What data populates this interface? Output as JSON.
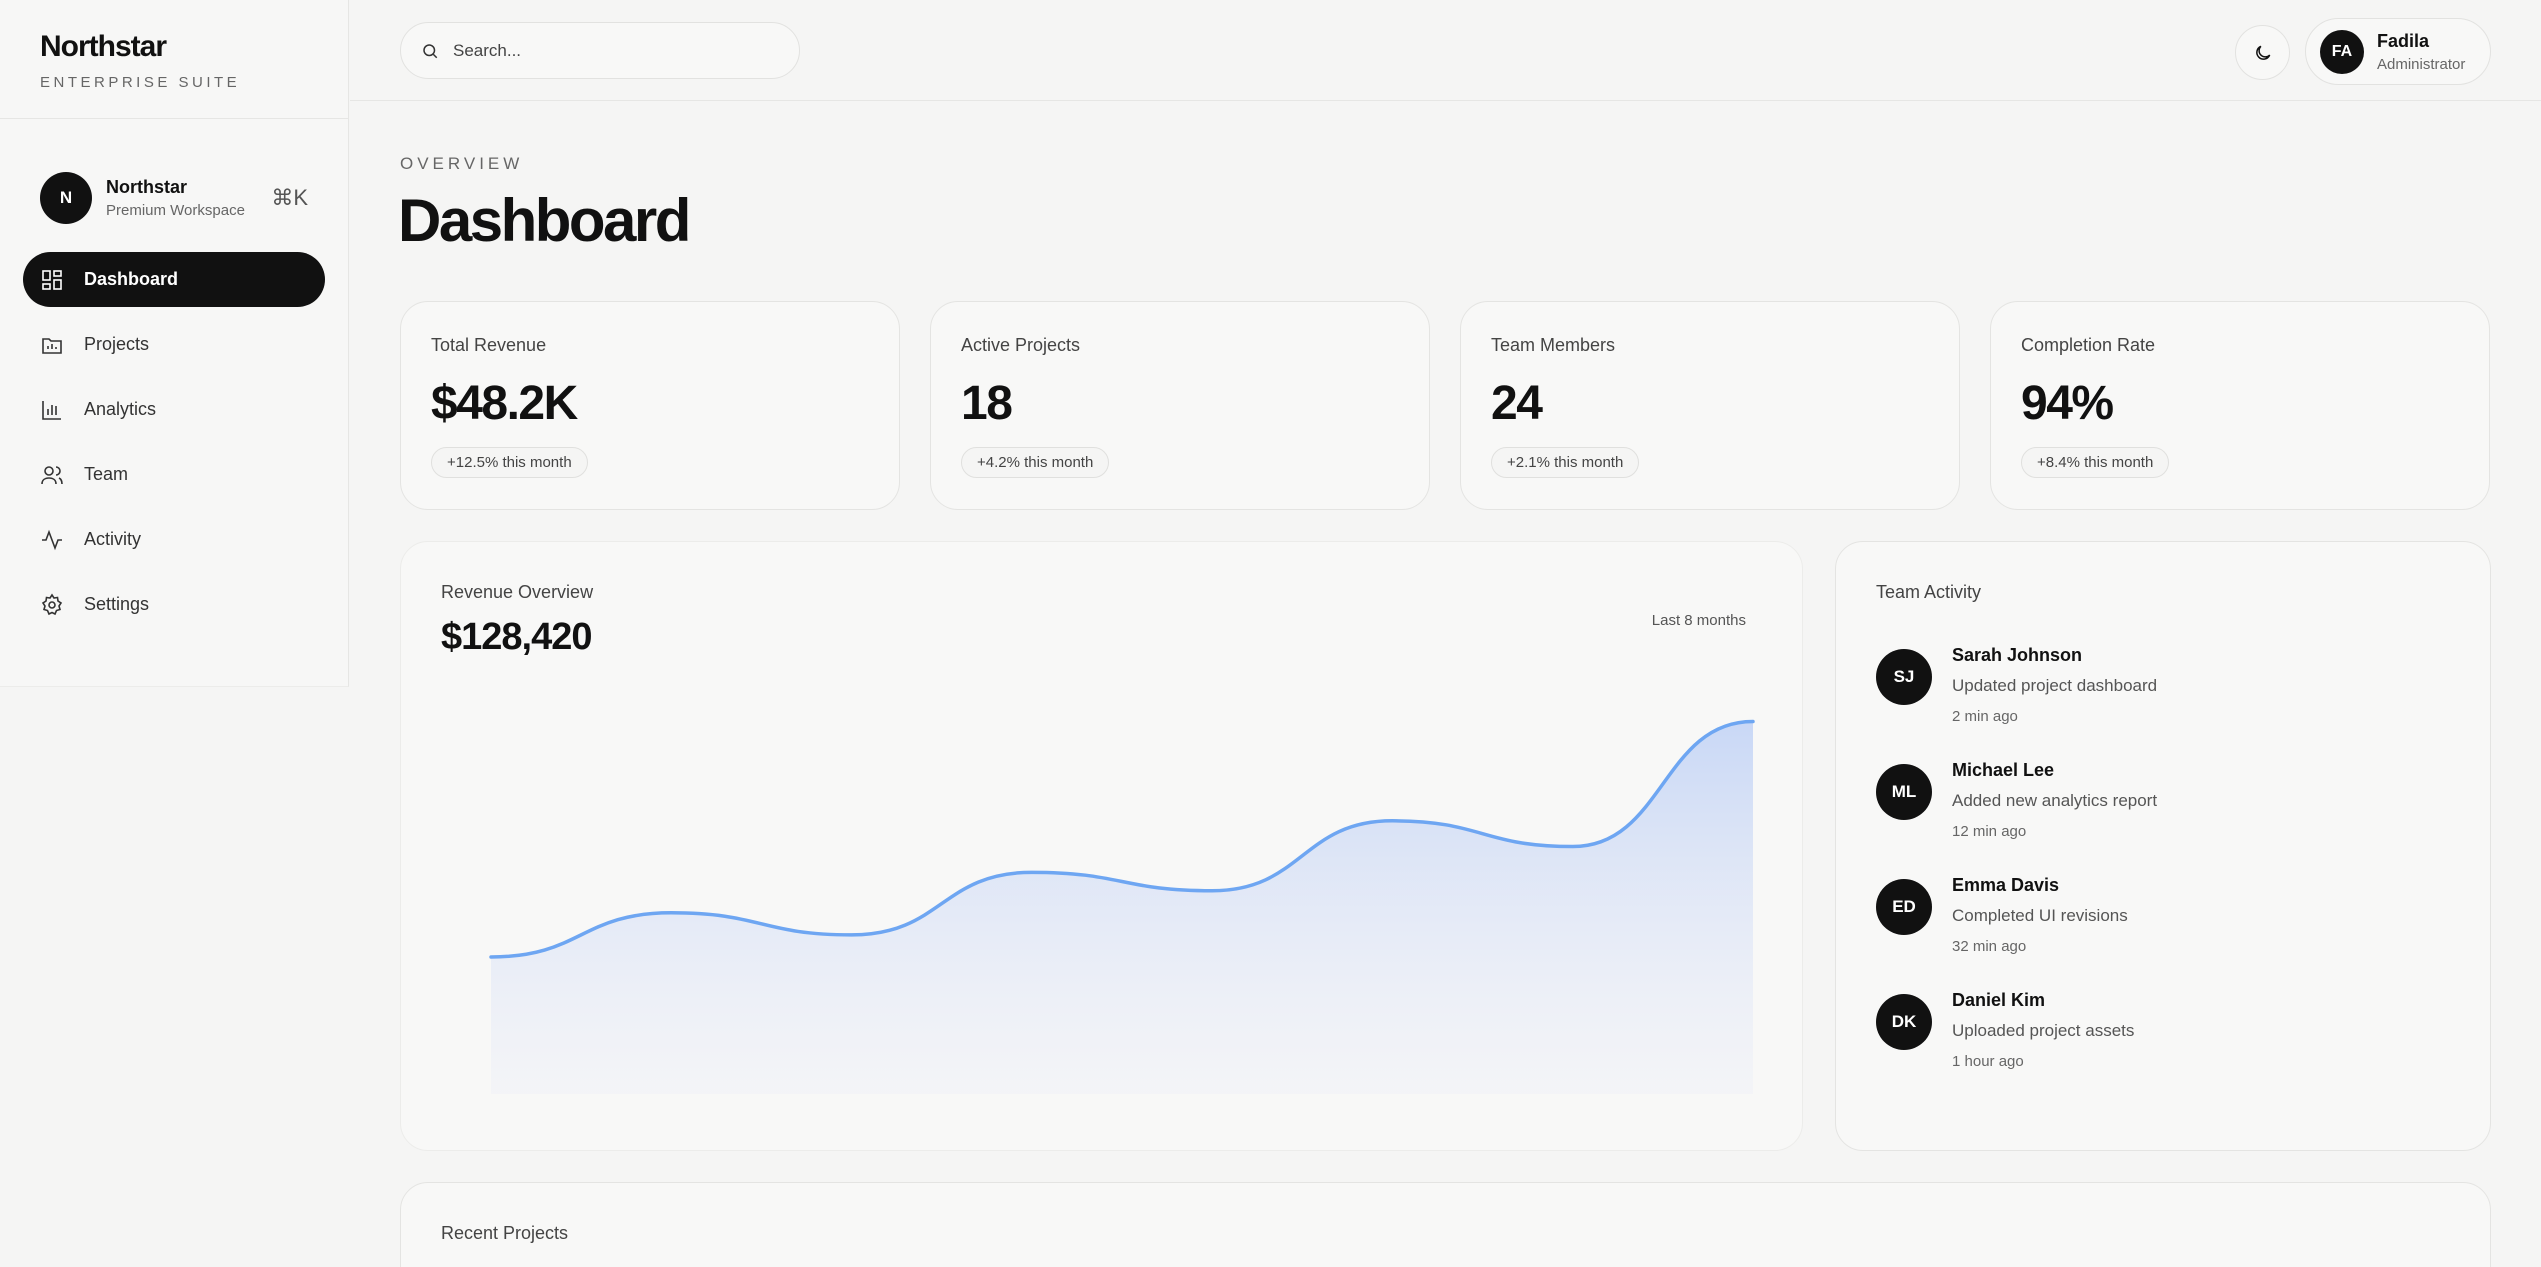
{
  "brand": {
    "name": "Northstar",
    "subtitle": "ENTERPRISE SUITE"
  },
  "workspace": {
    "initial": "N",
    "name": "Northstar",
    "plan": "Premium Workspace",
    "shortcut": "⌘K"
  },
  "nav": [
    {
      "label": "Dashboard",
      "icon": "grid-icon",
      "active": true
    },
    {
      "label": "Projects",
      "icon": "folder-icon",
      "active": false
    },
    {
      "label": "Analytics",
      "icon": "bar-chart-icon",
      "active": false
    },
    {
      "label": "Team",
      "icon": "users-icon",
      "active": false
    },
    {
      "label": "Activity",
      "icon": "pulse-icon",
      "active": false
    },
    {
      "label": "Settings",
      "icon": "gear-icon",
      "active": false
    }
  ],
  "search": {
    "placeholder": "Search..."
  },
  "user": {
    "initials": "FA",
    "name": "Fadila",
    "role": "Administrator"
  },
  "page": {
    "eyebrow": "OVERVIEW",
    "title": "Dashboard"
  },
  "stats": [
    {
      "label": "Total Revenue",
      "value": "$48.2K",
      "change": "+12.5% this month"
    },
    {
      "label": "Active Projects",
      "value": "18",
      "change": "+4.2% this month"
    },
    {
      "label": "Team Members",
      "value": "24",
      "change": "+2.1% this month"
    },
    {
      "label": "Completion Rate",
      "value": "94%",
      "change": "+8.4% this month"
    }
  ],
  "revenue": {
    "label": "Revenue Overview",
    "total": "$128,420",
    "range": "Last 8 months",
    "line_color": "#6ea6f2"
  },
  "chart_data": {
    "type": "area",
    "x": [
      1,
      2,
      3,
      4,
      5,
      6,
      7,
      8
    ],
    "values": [
      58,
      70,
      64,
      81,
      76,
      95,
      88,
      122
    ],
    "title": "Revenue Overview",
    "xlabel": "",
    "ylabel": "",
    "grid": false
  },
  "activity": {
    "title": "Team Activity",
    "items": [
      {
        "initials": "SJ",
        "name": "Sarah Johnson",
        "action": "Updated project dashboard",
        "time": "2 min ago"
      },
      {
        "initials": "ML",
        "name": "Michael Lee",
        "action": "Added new analytics report",
        "time": "12 min ago"
      },
      {
        "initials": "ED",
        "name": "Emma Davis",
        "action": "Completed UI revisions",
        "time": "32 min ago"
      },
      {
        "initials": "DK",
        "name": "Daniel Kim",
        "action": "Uploaded project assets",
        "time": "1 hour ago"
      }
    ]
  },
  "recent": {
    "title": "Recent Projects"
  }
}
